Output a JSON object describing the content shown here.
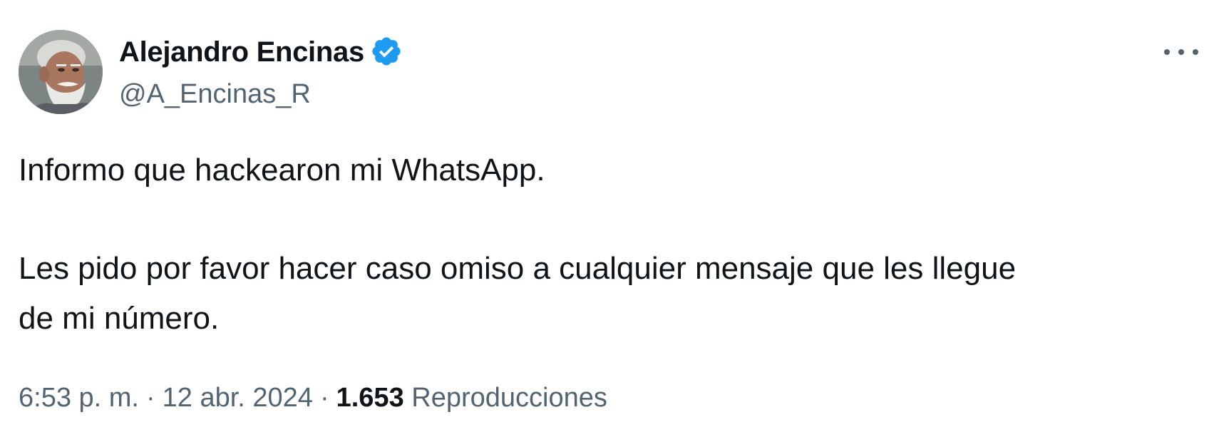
{
  "author": {
    "name": "Alejandro Encinas",
    "handle": "@A_Encinas_R",
    "verified": true,
    "verified_color": "#1d9bf0",
    "avatar_icon": "profile-photo"
  },
  "more_icon": "more-horizontal-icon",
  "tweet": {
    "line1": "Informo que hackearon mi WhatsApp.",
    "line2": "Les pido por favor hacer caso omiso a cualquier mensaje que les llegue",
    "line3": "de mi número."
  },
  "meta": {
    "time": "6:53 p. m.",
    "separator": "·",
    "date": "12 abr. 2024",
    "views_count": "1.653",
    "views_label": "Reproducciones"
  },
  "colors": {
    "text_primary": "#0f1419",
    "text_secondary": "#536471",
    "accent": "#1d9bf0"
  }
}
